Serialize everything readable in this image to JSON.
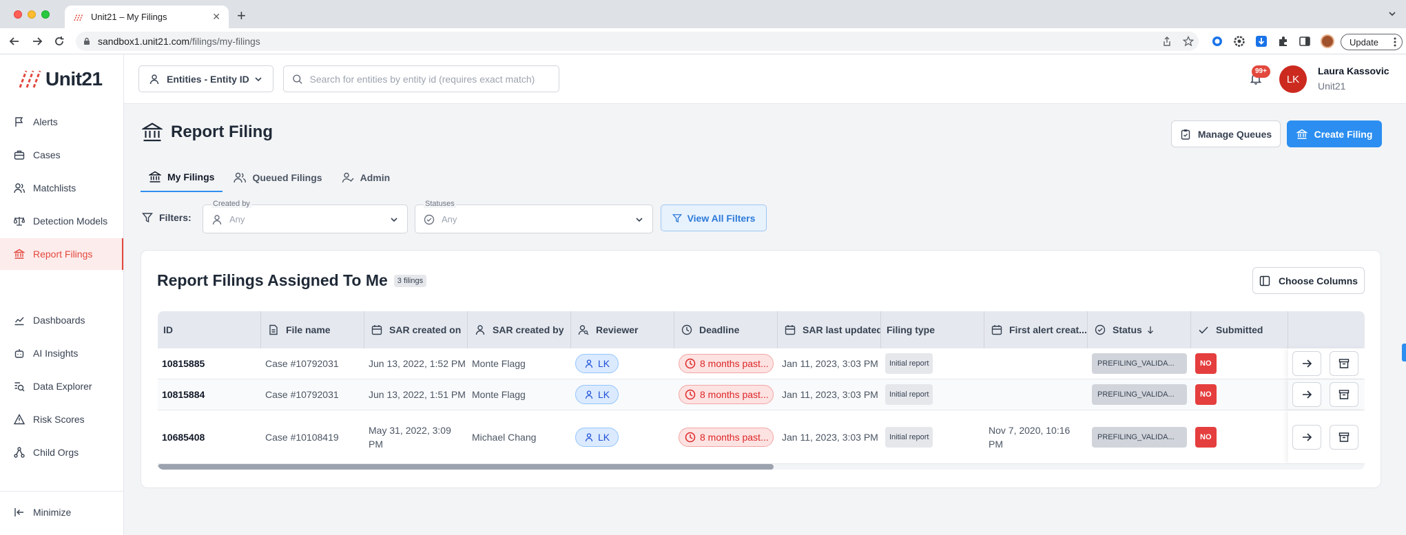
{
  "browser": {
    "tab_title": "Unit21 – My Filings",
    "url_host": "sandbox1.unit21.com",
    "url_path": "/filings/my-filings",
    "update_label": "Update"
  },
  "logo_text": "Unit21",
  "sidebar": {
    "items": [
      {
        "label": "Alerts",
        "icon": "flag-icon"
      },
      {
        "label": "Cases",
        "icon": "briefcase-icon"
      },
      {
        "label": "Matchlists",
        "icon": "users-icon"
      },
      {
        "label": "Detection Models",
        "icon": "scale-icon"
      },
      {
        "label": "Report Filings",
        "icon": "bank-icon",
        "active": true
      },
      {
        "label": "Dashboards",
        "icon": "chart-line-icon"
      },
      {
        "label": "AI Insights",
        "icon": "robot-icon"
      },
      {
        "label": "Data Explorer",
        "icon": "search-data-icon"
      },
      {
        "label": "Risk Scores",
        "icon": "warning-icon"
      },
      {
        "label": "Child Orgs",
        "icon": "hierarchy-icon"
      }
    ],
    "minimize_label": "Minimize"
  },
  "topbar": {
    "entity_select": "Entities - Entity ID",
    "search_placeholder": "Search for entities by entity id (requires exact match)",
    "notif_count": "99+",
    "avatar_initials": "LK",
    "user_name": "Laura Kassovic",
    "user_org": "Unit21"
  },
  "page": {
    "title": "Report Filing",
    "manage_queues": "Manage Queues",
    "create_filing": "Create Filing",
    "tabs": [
      {
        "label": "My Filings",
        "active": true
      },
      {
        "label": "Queued Filings"
      },
      {
        "label": "Admin"
      }
    ],
    "filters_label": "Filters:",
    "filter_created_by": {
      "label": "Created by",
      "value": "Any"
    },
    "filter_statuses": {
      "label": "Statuses",
      "value": "Any"
    },
    "view_all_filters": "View All Filters"
  },
  "card": {
    "title": "Report Filings Assigned To Me",
    "count": "3 filings",
    "choose_columns": "Choose Columns"
  },
  "table": {
    "columns": [
      "ID",
      "File name",
      "SAR created on",
      "SAR created by",
      "Reviewer",
      "Deadline",
      "SAR last updated",
      "Filing type",
      "First alert creat...",
      "Status",
      "Submitted"
    ],
    "rows": [
      {
        "id": "10815885",
        "file_name": "Case #10792031",
        "created_on": "Jun 13, 2022, 1:52 PM",
        "created_by": "Monte Flagg",
        "reviewer": "LK",
        "deadline": "8 months past...",
        "last_updated": "Jan 11, 2023, 3:03 PM",
        "filing_type": "Initial report",
        "first_alert": "",
        "status": "PREFILING_VALIDA...",
        "submitted": "NO"
      },
      {
        "id": "10815884",
        "file_name": "Case #10792031",
        "created_on": "Jun 13, 2022, 1:51 PM",
        "created_by": "Monte Flagg",
        "reviewer": "LK",
        "deadline": "8 months past...",
        "last_updated": "Jan 11, 2023, 3:03 PM",
        "filing_type": "Initial report",
        "first_alert": "",
        "status": "PREFILING_VALIDA...",
        "submitted": "NO"
      },
      {
        "id": "10685408",
        "file_name": "Case #10108419",
        "created_on": "May 31, 2022, 3:09 PM",
        "created_by": "Michael Chang",
        "reviewer": "LK",
        "deadline": "8 months past...",
        "last_updated": "Jan 11, 2023, 3:03 PM",
        "filing_type": "Initial report",
        "first_alert": "Nov 7, 2020, 10:16 PM",
        "status": "PREFILING_VALIDA...",
        "submitted": "NO"
      }
    ],
    "scroll_fraction": 0.51
  },
  "colors": {
    "brand_red": "#e2483d",
    "primary_blue": "#2b8ef0"
  }
}
